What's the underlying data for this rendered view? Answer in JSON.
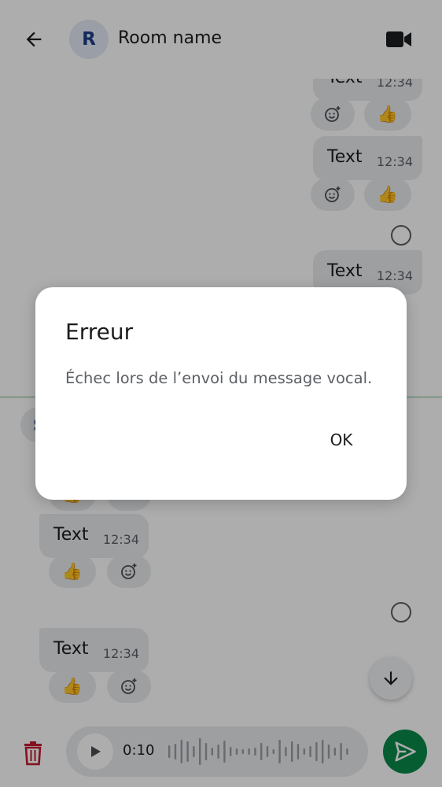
{
  "topbar": {
    "avatar_initial": "R",
    "room_name": "Room name"
  },
  "timeline": {
    "messages": [
      {
        "text": "Text",
        "time": "12:34"
      },
      {
        "text": "Text",
        "time": "12:34"
      },
      {
        "text": "Text",
        "time": "12:34"
      },
      {
        "text": "Text",
        "time": "12:34"
      },
      {
        "text": "Text",
        "time": "12:34"
      }
    ],
    "reaction_emoji": "👍",
    "date_chip_initial": "S"
  },
  "composer": {
    "voice_duration": "0:10"
  },
  "dialog": {
    "title": "Erreur",
    "message": "Échec lors de l’envoi du message vocal.",
    "ok_label": "OK"
  },
  "colors": {
    "accent": "#0b8a4a",
    "danger": "#c4182f",
    "avatar_bg": "#e3e9f5",
    "avatar_fg": "#1e3f8a",
    "bubble_bg": "#e8eaee"
  }
}
